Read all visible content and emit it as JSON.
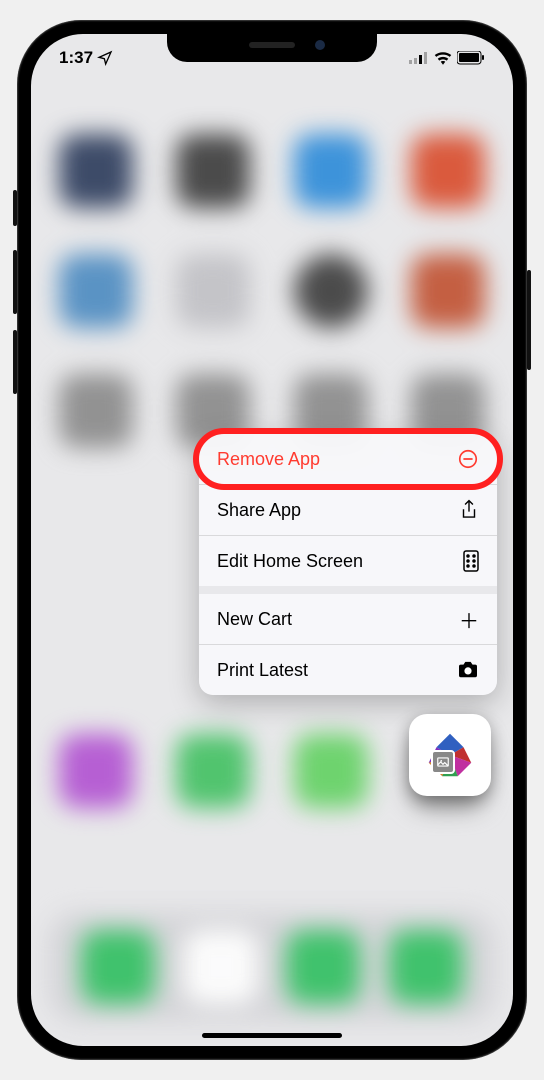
{
  "status": {
    "time": "1:37"
  },
  "menu": {
    "items": [
      {
        "label": "Remove App",
        "kind": "remove"
      },
      {
        "label": "Share App",
        "kind": "share"
      },
      {
        "label": "Edit Home Screen",
        "kind": "edit"
      },
      {
        "label": "New Cart",
        "kind": "cart"
      },
      {
        "label": "Print Latest",
        "kind": "print"
      }
    ]
  },
  "colors": {
    "destructive": "#ff3b30",
    "highlight": "#ff2020"
  }
}
